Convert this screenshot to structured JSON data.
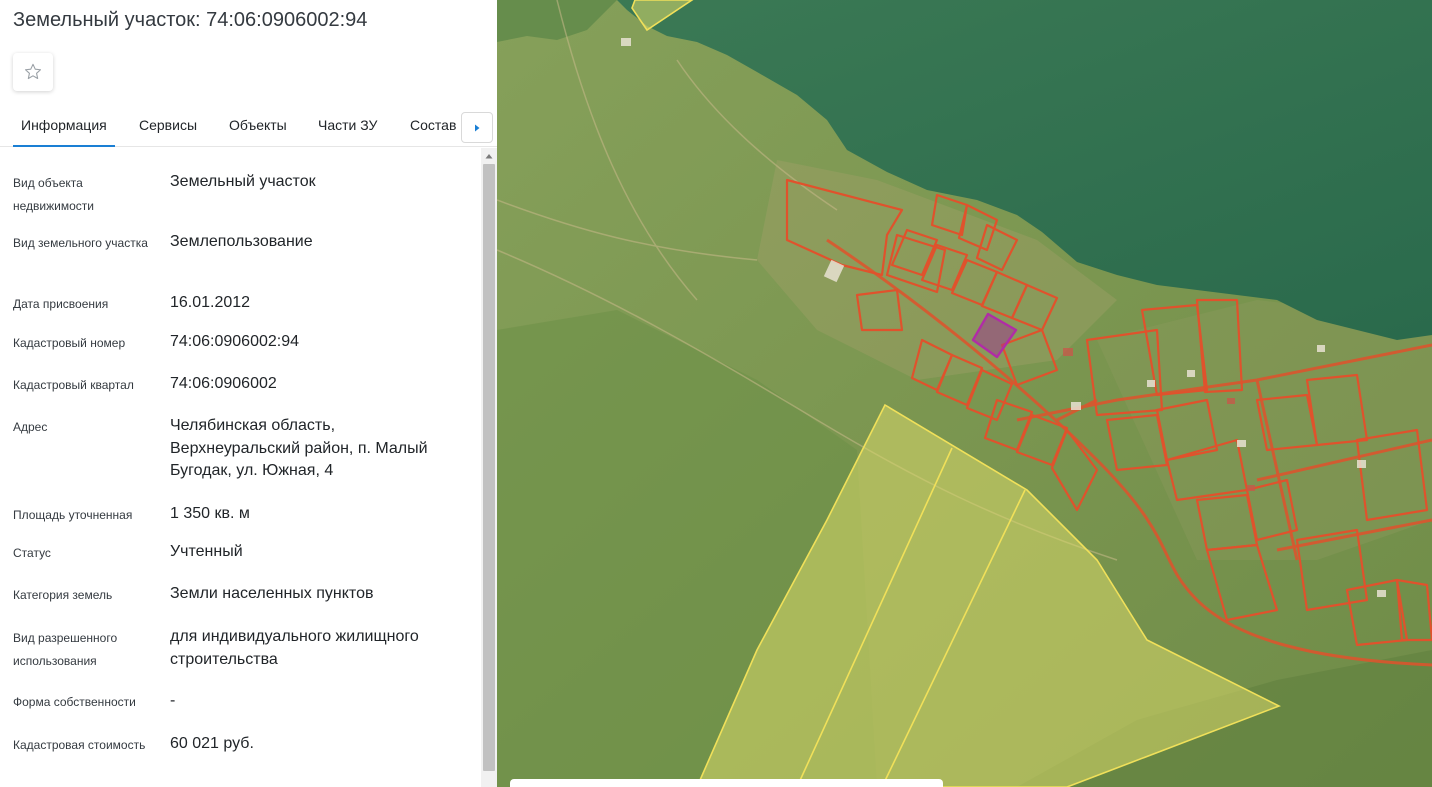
{
  "panel": {
    "title": "Земельный участок: 74:06:0906002:94",
    "favorite_icon": "star-outline-icon",
    "tabs": [
      {
        "label": "Информация",
        "active": true
      },
      {
        "label": "Сервисы",
        "active": false
      },
      {
        "label": "Объекты",
        "active": false
      },
      {
        "label": "Части ЗУ",
        "active": false
      },
      {
        "label": "Состав",
        "active": false
      }
    ],
    "tabs_next_icon": "caret-right-icon",
    "properties": [
      {
        "label": "Вид объекта недвижимости",
        "value": "Земельный участок"
      },
      {
        "label": "Вид земельного участка",
        "value": "Землепользование"
      },
      {
        "label": "Дата присвоения",
        "value": "16.01.2012"
      },
      {
        "label": "Кадастровый номер",
        "value": "74:06:0906002:94"
      },
      {
        "label": "Кадастровый квартал",
        "value": "74:06:0906002"
      },
      {
        "label": "Адрес",
        "value": "Челябинская область, Верхнеуральский район, п. Малый Бугодак, ул. Южная, 4"
      },
      {
        "label": "Площадь уточненная",
        "value": "1 350 кв. м"
      },
      {
        "label": "Статус",
        "value": "Учтенный"
      },
      {
        "label": "Категория земель",
        "value": "Земли населенных пунктов"
      },
      {
        "label": "Вид разрешенного использования",
        "value": "для индивидуального жилищного строительства"
      },
      {
        "label": "Форма собственности",
        "value": "-"
      },
      {
        "label": "Кадастровая стоимость",
        "value": "60 021 руб."
      }
    ]
  },
  "map": {
    "colors": {
      "water": "#2f7050",
      "land": "#7e9a52",
      "field": "#6d8f48",
      "parcel_outline": "#e0522c",
      "selected_parcel": "#a02c9a",
      "agri_parcel_fill": "#d8d86a",
      "agri_parcel_outline": "#f0e05a"
    }
  }
}
